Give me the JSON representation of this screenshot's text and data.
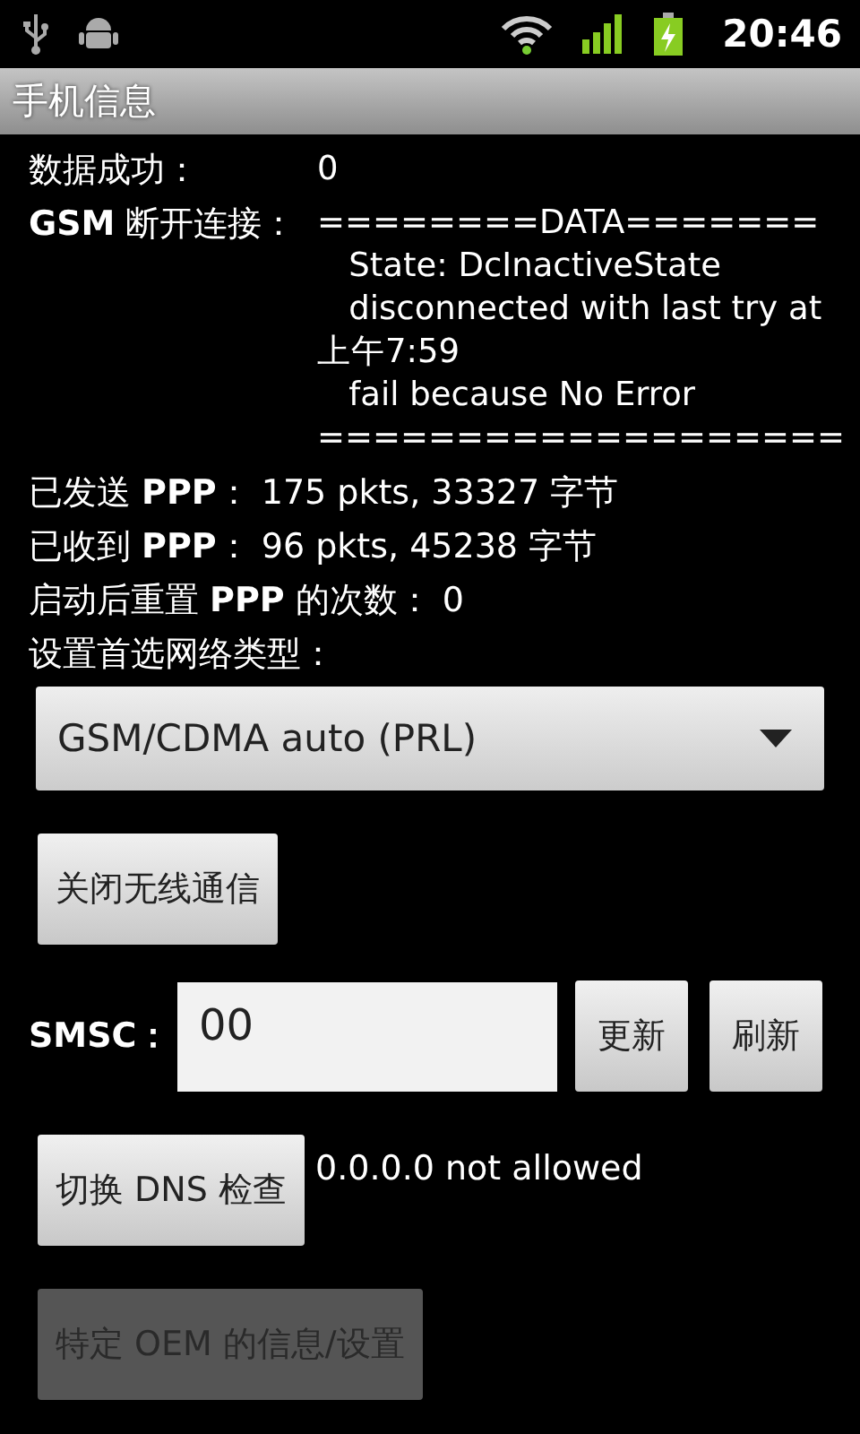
{
  "status_bar": {
    "time": "20:46"
  },
  "title": "手机信息",
  "fields": [
    {
      "label": "数据成功：",
      "value_lines": [
        "0"
      ]
    },
    {
      "label": "**GSM** 断开连接：",
      "value_lines": [
        "========DATA=======",
        "   State: DcInactiveState",
        "   disconnected with last try at",
        "上午7:59",
        "   fail because No Error",
        "==================="
      ]
    }
  ],
  "stats": [
    "已发送 **PPP**： 175 pkts, 33327 字节",
    "已收到 **PPP**： 96 pkts, 45238 字节",
    "启动后重置 **PPP** 的次数： 0",
    "设置首选网络类型："
  ],
  "network_spinner": {
    "value": "GSM/CDMA auto (PRL)"
  },
  "radio_button": {
    "label": "关闭无线通信",
    "disabled": false
  },
  "smsc": {
    "label": "SMSC：",
    "value": "00",
    "buttons": [
      {
        "label": "更新",
        "disabled": false
      },
      {
        "label": "刷新",
        "disabled": false
      }
    ]
  },
  "dns": {
    "button": {
      "label": "切换 DNS 检查",
      "disabled": false
    },
    "status": "0.0.0.0 not allowed"
  },
  "oem_button": {
    "label": "特定 OEM 的信息/设置",
    "disabled": true
  }
}
